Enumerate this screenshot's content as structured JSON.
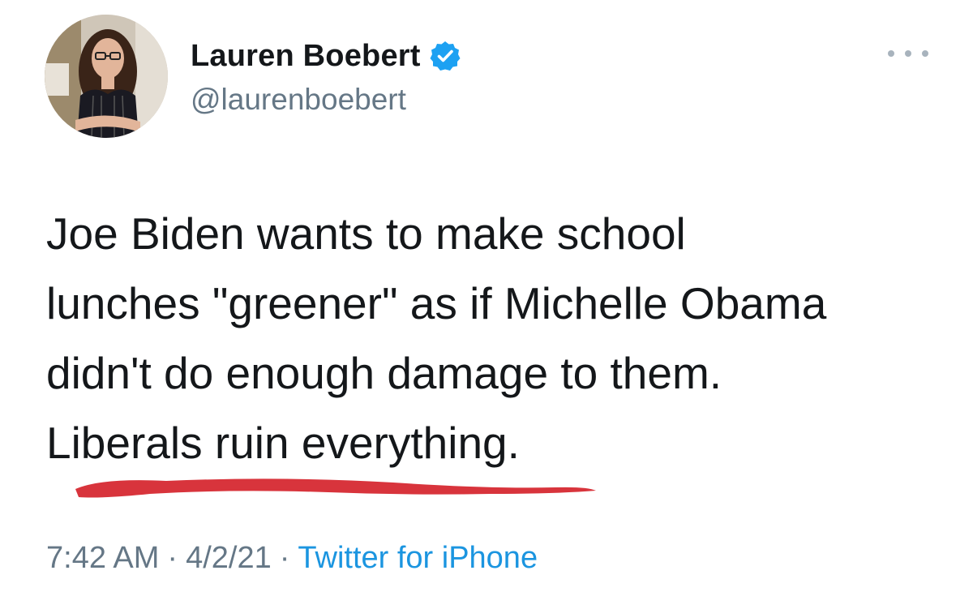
{
  "author": {
    "display_name": "Lauren Boebert",
    "handle": "@laurenboebert",
    "verified": true
  },
  "tweet": {
    "lines": [
      "Joe Biden wants to make school",
      "lunches \"greener\" as if Michelle Obama",
      "didn't do enough damage to them.",
      "Liberals ruin everything."
    ]
  },
  "meta": {
    "time": "7:42 AM",
    "date": "4/2/21",
    "separator": "·",
    "source": "Twitter for iPhone"
  },
  "icons": {
    "more": "more-options-icon",
    "verified": "verified-badge-icon"
  },
  "colors": {
    "text": "#14171a",
    "secondary": "#657786",
    "link": "#1b95e0",
    "verified": "#1da1f2",
    "annotation": "#d8343c"
  }
}
